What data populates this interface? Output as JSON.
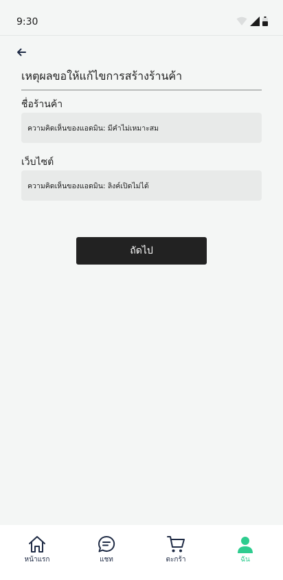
{
  "status_bar": {
    "time": "9:30"
  },
  "page": {
    "title": "เหตุผลขอให้แก้ไขการสร้างร้านค้า",
    "fields": [
      {
        "label": "ชื่อร้านค้า",
        "value": "ความคิดเห็นของแอดมิน: มีคำไม่เหมาะสม"
      },
      {
        "label": "เว็บไซต์",
        "value": "ความคิดเห็นของแอดมิน: ลิงค์เปิดไม่ได้"
      }
    ],
    "next_label": "ถัดไป"
  },
  "bottom_nav": {
    "items": [
      {
        "label": "หน้าแรก",
        "icon": "home-icon",
        "active": false
      },
      {
        "label": "แชท",
        "icon": "chat-icon",
        "active": false
      },
      {
        "label": "ตะกร้า",
        "icon": "cart-icon",
        "active": false
      },
      {
        "label": "ฉัน",
        "icon": "person-icon",
        "active": true
      }
    ]
  },
  "colors": {
    "accent": "#2ecc8f",
    "nav_icon": "#1e2a44",
    "button": "#222222",
    "field_bg": "#e8eae9"
  }
}
